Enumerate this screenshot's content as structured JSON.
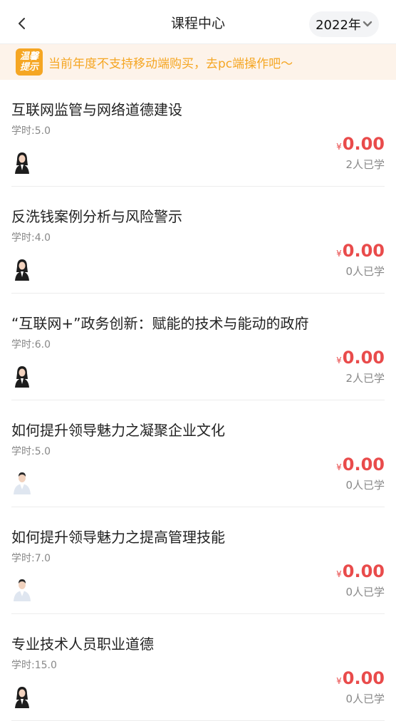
{
  "header": {
    "title": "课程中心",
    "year_label": "2022年"
  },
  "notice": {
    "badge_line1": "温馨",
    "badge_line2": "提示",
    "text": "当前年度不支持移动端购买，去pc端操作吧～"
  },
  "labels": {
    "hours_prefix": "学时:",
    "currency": "¥"
  },
  "courses": [
    {
      "title": "互联网监管与网络道德建设",
      "hours": "5.0",
      "price": "0.00",
      "learners": "2人已学",
      "avatar": "female-teacher-avatar"
    },
    {
      "title": "反洗钱案例分析与风险警示",
      "hours": "4.0",
      "price": "0.00",
      "learners": "0人已学",
      "avatar": "female-teacher-avatar"
    },
    {
      "title": "“互联网+”政务创新：赋能的技术与能动的政府",
      "hours": "6.0",
      "price": "0.00",
      "learners": "2人已学",
      "avatar": "female-teacher-avatar"
    },
    {
      "title": "如何提升领导魅力之凝聚企业文化",
      "hours": "5.0",
      "price": "0.00",
      "learners": "0人已学",
      "avatar": "male-teacher-avatar"
    },
    {
      "title": "如何提升领导魅力之提高管理技能",
      "hours": "7.0",
      "price": "0.00",
      "learners": "0人已学",
      "avatar": "male-teacher-avatar"
    },
    {
      "title": "专业技术人员职业道德",
      "hours": "15.0",
      "price": "0.00",
      "learners": "0人已学",
      "avatar": "female-teacher-avatar"
    }
  ],
  "colors": {
    "accent": "#f5a623",
    "price": "#e94b4b",
    "notice_bg": "#fdf3ea"
  }
}
